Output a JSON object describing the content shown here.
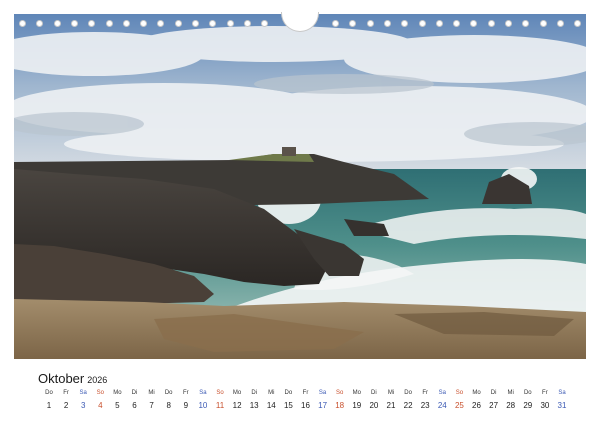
{
  "colors": {
    "saturday": "#3c5ab4",
    "sunday": "#c8502d",
    "text": "#222222"
  },
  "photo": {
    "subject": "rocky coastline with crashing waves under cloudy sky"
  },
  "calendar": {
    "month": "Oktober",
    "year": "2026",
    "days": [
      {
        "wd": "Do",
        "d": "1"
      },
      {
        "wd": "Fr",
        "d": "2"
      },
      {
        "wd": "Sa",
        "d": "3"
      },
      {
        "wd": "So",
        "d": "4"
      },
      {
        "wd": "Mo",
        "d": "5"
      },
      {
        "wd": "Di",
        "d": "6"
      },
      {
        "wd": "Mi",
        "d": "7"
      },
      {
        "wd": "Do",
        "d": "8"
      },
      {
        "wd": "Fr",
        "d": "9"
      },
      {
        "wd": "Sa",
        "d": "10"
      },
      {
        "wd": "So",
        "d": "11"
      },
      {
        "wd": "Mo",
        "d": "12"
      },
      {
        "wd": "Di",
        "d": "13"
      },
      {
        "wd": "Mi",
        "d": "14"
      },
      {
        "wd": "Do",
        "d": "15"
      },
      {
        "wd": "Fr",
        "d": "16"
      },
      {
        "wd": "Sa",
        "d": "17"
      },
      {
        "wd": "So",
        "d": "18"
      },
      {
        "wd": "Mo",
        "d": "19"
      },
      {
        "wd": "Di",
        "d": "20"
      },
      {
        "wd": "Mi",
        "d": "21"
      },
      {
        "wd": "Do",
        "d": "22"
      },
      {
        "wd": "Fr",
        "d": "23"
      },
      {
        "wd": "Sa",
        "d": "24"
      },
      {
        "wd": "So",
        "d": "25"
      },
      {
        "wd": "Mo",
        "d": "26"
      },
      {
        "wd": "Di",
        "d": "27"
      },
      {
        "wd": "Mi",
        "d": "28"
      },
      {
        "wd": "Do",
        "d": "29"
      },
      {
        "wd": "Fr",
        "d": "30"
      },
      {
        "wd": "Sa",
        "d": "31"
      }
    ]
  }
}
